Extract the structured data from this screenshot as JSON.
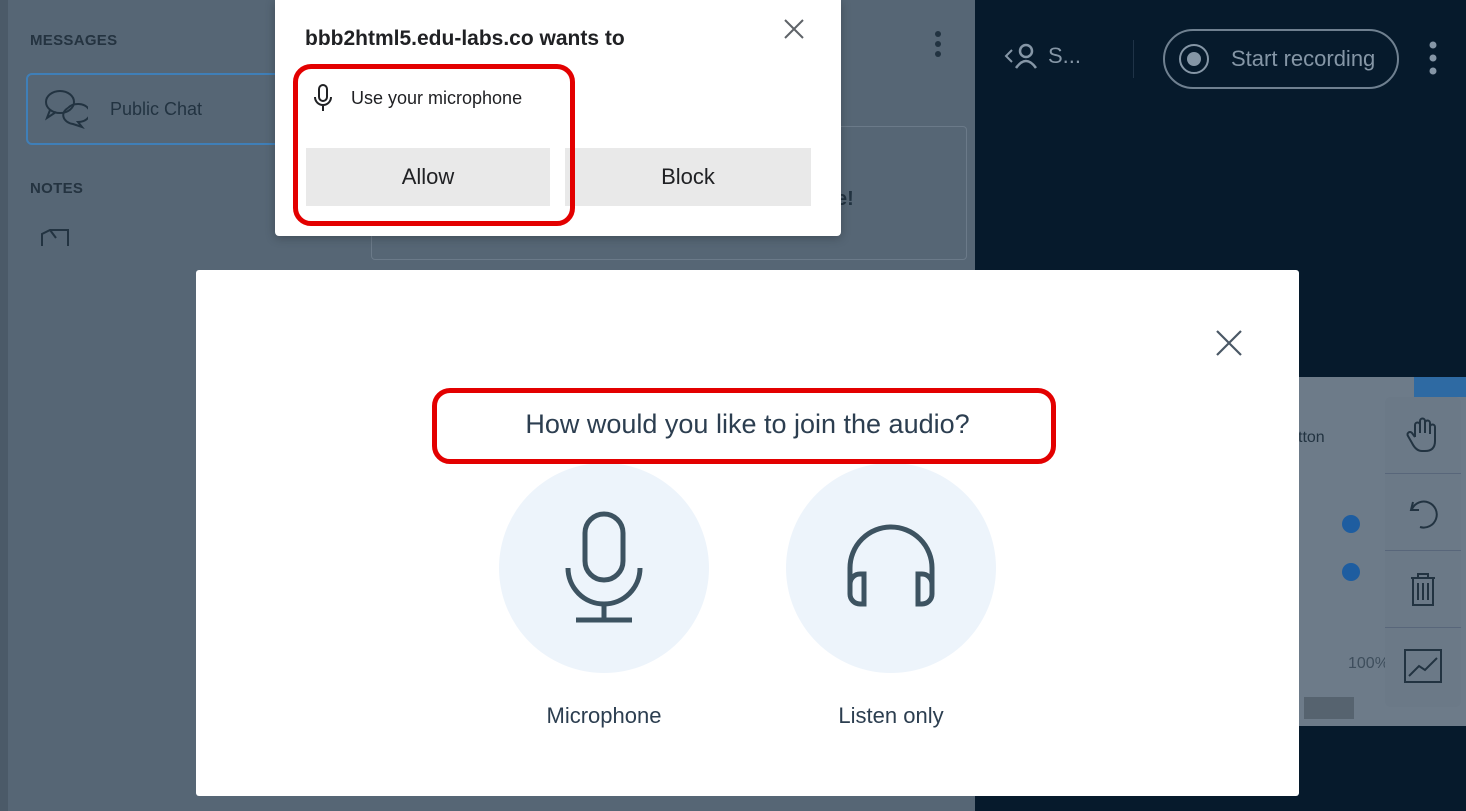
{
  "background": {
    "sidebar": {
      "messages_label": "MESSAGES",
      "public_chat_label": "Public Chat",
      "notes_label": "NOTES"
    },
    "ghost_text": "e!",
    "user_label": "S...",
    "record_button_label": "Start recording",
    "slide_text": "tton",
    "slide_pct": "100%"
  },
  "permission_popup": {
    "title": "bbb2html5.edu-labs.co wants to",
    "permission_text": "Use your microphone",
    "allow_label": "Allow",
    "block_label": "Block",
    "icons": [
      "close-icon",
      "microphone-icon"
    ]
  },
  "audio_modal": {
    "question": "How would you like to join the audio?",
    "options": [
      {
        "label": "Microphone",
        "icon": "microphone-icon"
      },
      {
        "label": "Listen only",
        "icon": "headphones-icon"
      }
    ]
  },
  "colors": {
    "highlight": "#e30000",
    "dark_panel": "#061a2c",
    "option_circle": "#edf4fb",
    "text": "#2c3e50"
  }
}
